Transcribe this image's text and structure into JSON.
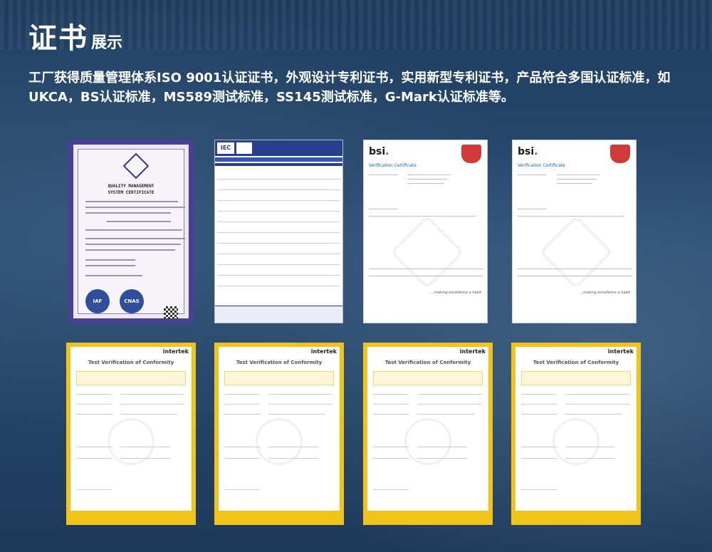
{
  "header": {
    "title_main": "证书",
    "title_sub": "展示",
    "description": "工厂获得质量管理体系ISO 9001认证证书，外观设计专利证书，实用新型专利证书，产品符合多国认证标准，如UKCA，BS认证标准，MS589测试标准，SS145测试标准，G-Mark认证标准等。"
  },
  "certificates": {
    "quality": {
      "title_line1": "QUALITY MANAGEMENT",
      "title_line2": "SYSTEM CERTIFICATE",
      "badge1": "IAF",
      "badge2": "CNAS"
    },
    "iec": {
      "logo": "IEC"
    },
    "bsi": [
      {
        "logo": "bsi",
        "title": "Verification Certificate",
        "slogan": "...making excellence a habit"
      },
      {
        "logo": "bsi",
        "title": "Verification Certificate",
        "slogan": "...making excellence a habit"
      }
    ],
    "intertek": [
      {
        "logo": "intertek",
        "title": "Test Verification of Conformity"
      },
      {
        "logo": "intertek",
        "title": "Test Verification of Conformity"
      },
      {
        "logo": "intertek",
        "title": "Test Verification of Conformity"
      },
      {
        "logo": "intertek",
        "title": "Test Verification of Conformity"
      }
    ]
  }
}
